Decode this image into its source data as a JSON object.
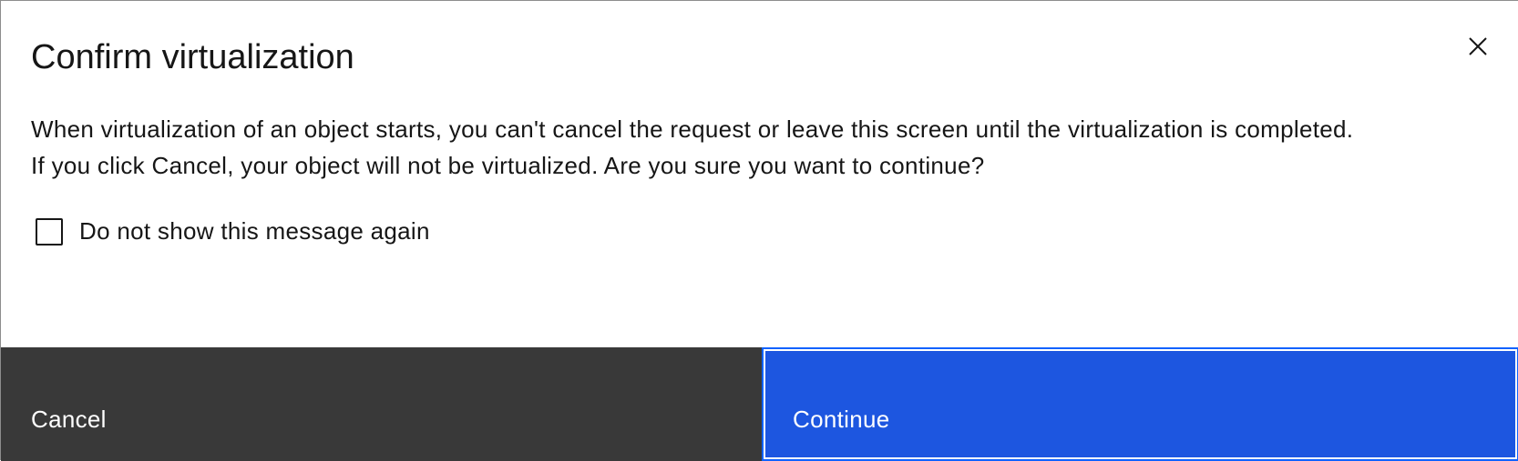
{
  "dialog": {
    "title": "Confirm virtualization",
    "close_icon": "close-icon",
    "body_line_1": "When virtualization of an object starts, you can't cancel the request or leave this screen until the virtualization is completed.",
    "body_line_2": "If you click Cancel, your object will not be virtualized. Are you sure you want to continue?",
    "checkbox": {
      "label": "Do not show this message again",
      "checked": false
    },
    "buttons": {
      "cancel_label": "Cancel",
      "continue_label": "Continue"
    }
  },
  "colors": {
    "secondary_button": "#393939",
    "primary_button": "#1d56e0",
    "focus_border": "#0f62fe",
    "text": "#161616"
  }
}
